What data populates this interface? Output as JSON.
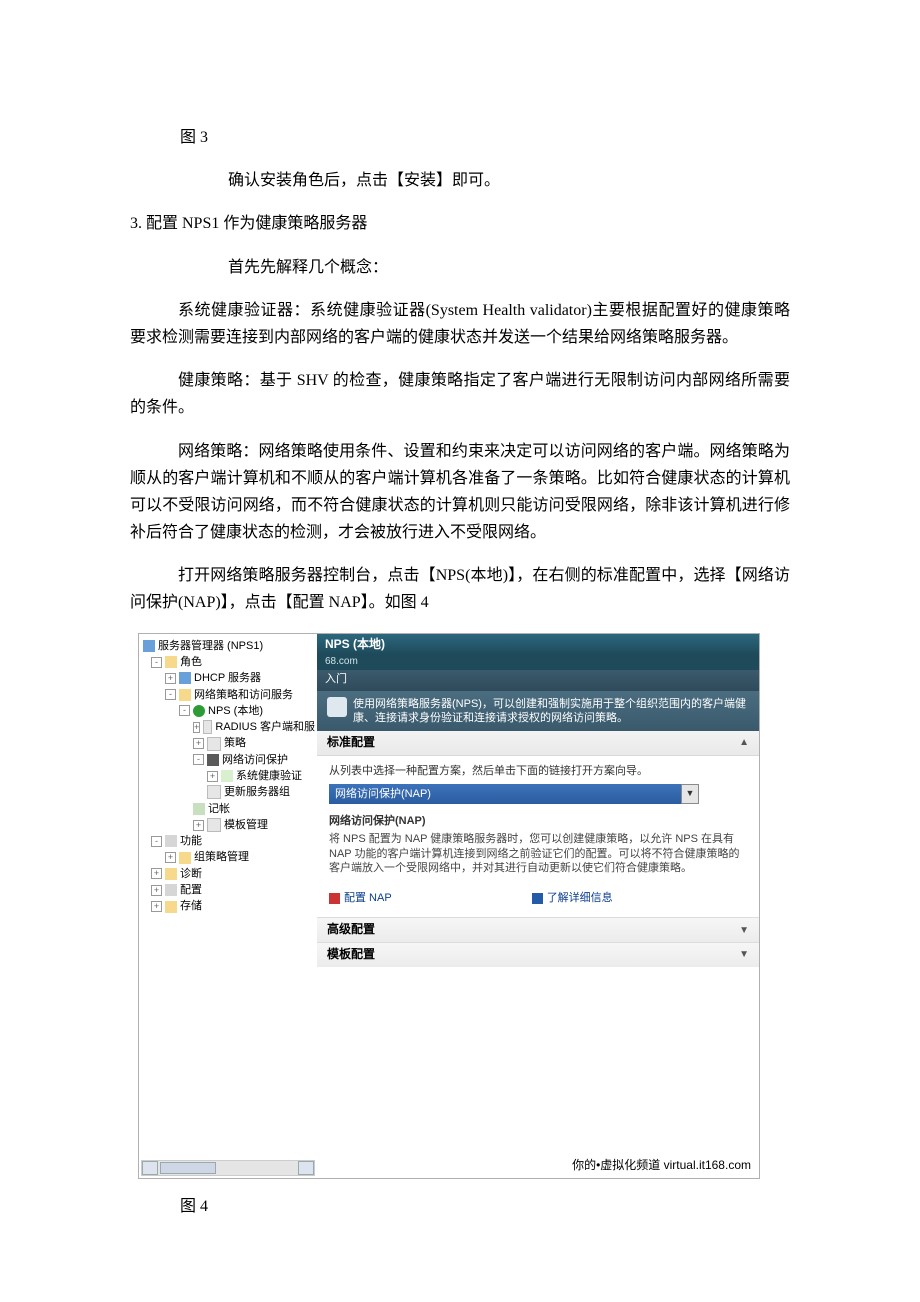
{
  "doc": {
    "fig3": "图 3",
    "p1": "确认安装角色后，点击【安装】即可。",
    "p2": "3. 配置 NPS1 作为健康策略服务器",
    "p3": "首先先解释几个概念：",
    "p4": "系统健康验证器：系统健康验证器(System Health validator)主要根据配置好的健康策略要求检测需要连接到内部网络的客户端的健康状态并发送一个结果给网络策略服务器。",
    "p5": "健康策略：基于 SHV 的检查，健康策略指定了客户端进行无限制访问内部网络所需要的条件。",
    "p6": "网络策略：网络策略使用条件、设置和约束来决定可以访问网络的客户端。网络策略为顺从的客户端计算机和不顺从的客户端计算机各准备了一条策略。比如符合健康状态的计算机可以不受限访问网络，而不符合健康状态的计算机则只能访问受限网络，除非该计算机进行修补后符合了健康状态的检测，才会被放行进入不受限网络。",
    "p7": "打开网络策略服务器控制台，点击【NPS(本地)】，在右侧的标准配置中，选择【网络访问保护(NAP)】，点击【配置 NAP】。如图 4",
    "fig4": "图 4"
  },
  "tree": {
    "root": "服务器管理器 (NPS1)",
    "roles": "角色",
    "dhcp": "DHCP 服务器",
    "npas": "网络策略和访问服务",
    "nps_local": "NPS (本地)",
    "radius": "RADIUS 客户端和服",
    "policies": "策略",
    "nap": "网络访问保护",
    "shv": "系统健康验证",
    "remediation": "更新服务器组",
    "accounting": "记帐",
    "template": "模板管理",
    "features": "功能",
    "gpm": "组策略管理",
    "diag": "诊断",
    "config": "配置",
    "storage": "存储"
  },
  "panel": {
    "title": "NPS (本地)",
    "sub": "68.com",
    "entry": "入门",
    "intro": "使用网络策略服务器(NPS)，可以创建和强制实施用于整个组织范围内的客户端健康、连接请求身份验证和连接请求授权的网络访问策略。",
    "std_hdr": "标准配置",
    "std_hint": "从列表中选择一种配置方案，然后单击下面的链接打开方案向导。",
    "dd_value": "网络访问保护(NAP)",
    "nap_title": "网络访问保护(NAP)",
    "nap_desc": "将 NPS 配置为 NAP 健康策略服务器时，您可以创建健康策略，以允许 NPS 在具有 NAP 功能的客户端计算机连接到网络之前验证它们的配置。可以将不符合健康策略的客户端放入一个受限网络中，并对其进行自动更新以使它们符合健康策略。",
    "link_configure": "配置 NAP",
    "link_learn": "了解详细信息",
    "adv_hdr": "高级配置",
    "tpl_hdr": "模板配置",
    "footer_brand": "你的",
    "footer_text": "虚拟化频道 virtual.it168.com"
  }
}
